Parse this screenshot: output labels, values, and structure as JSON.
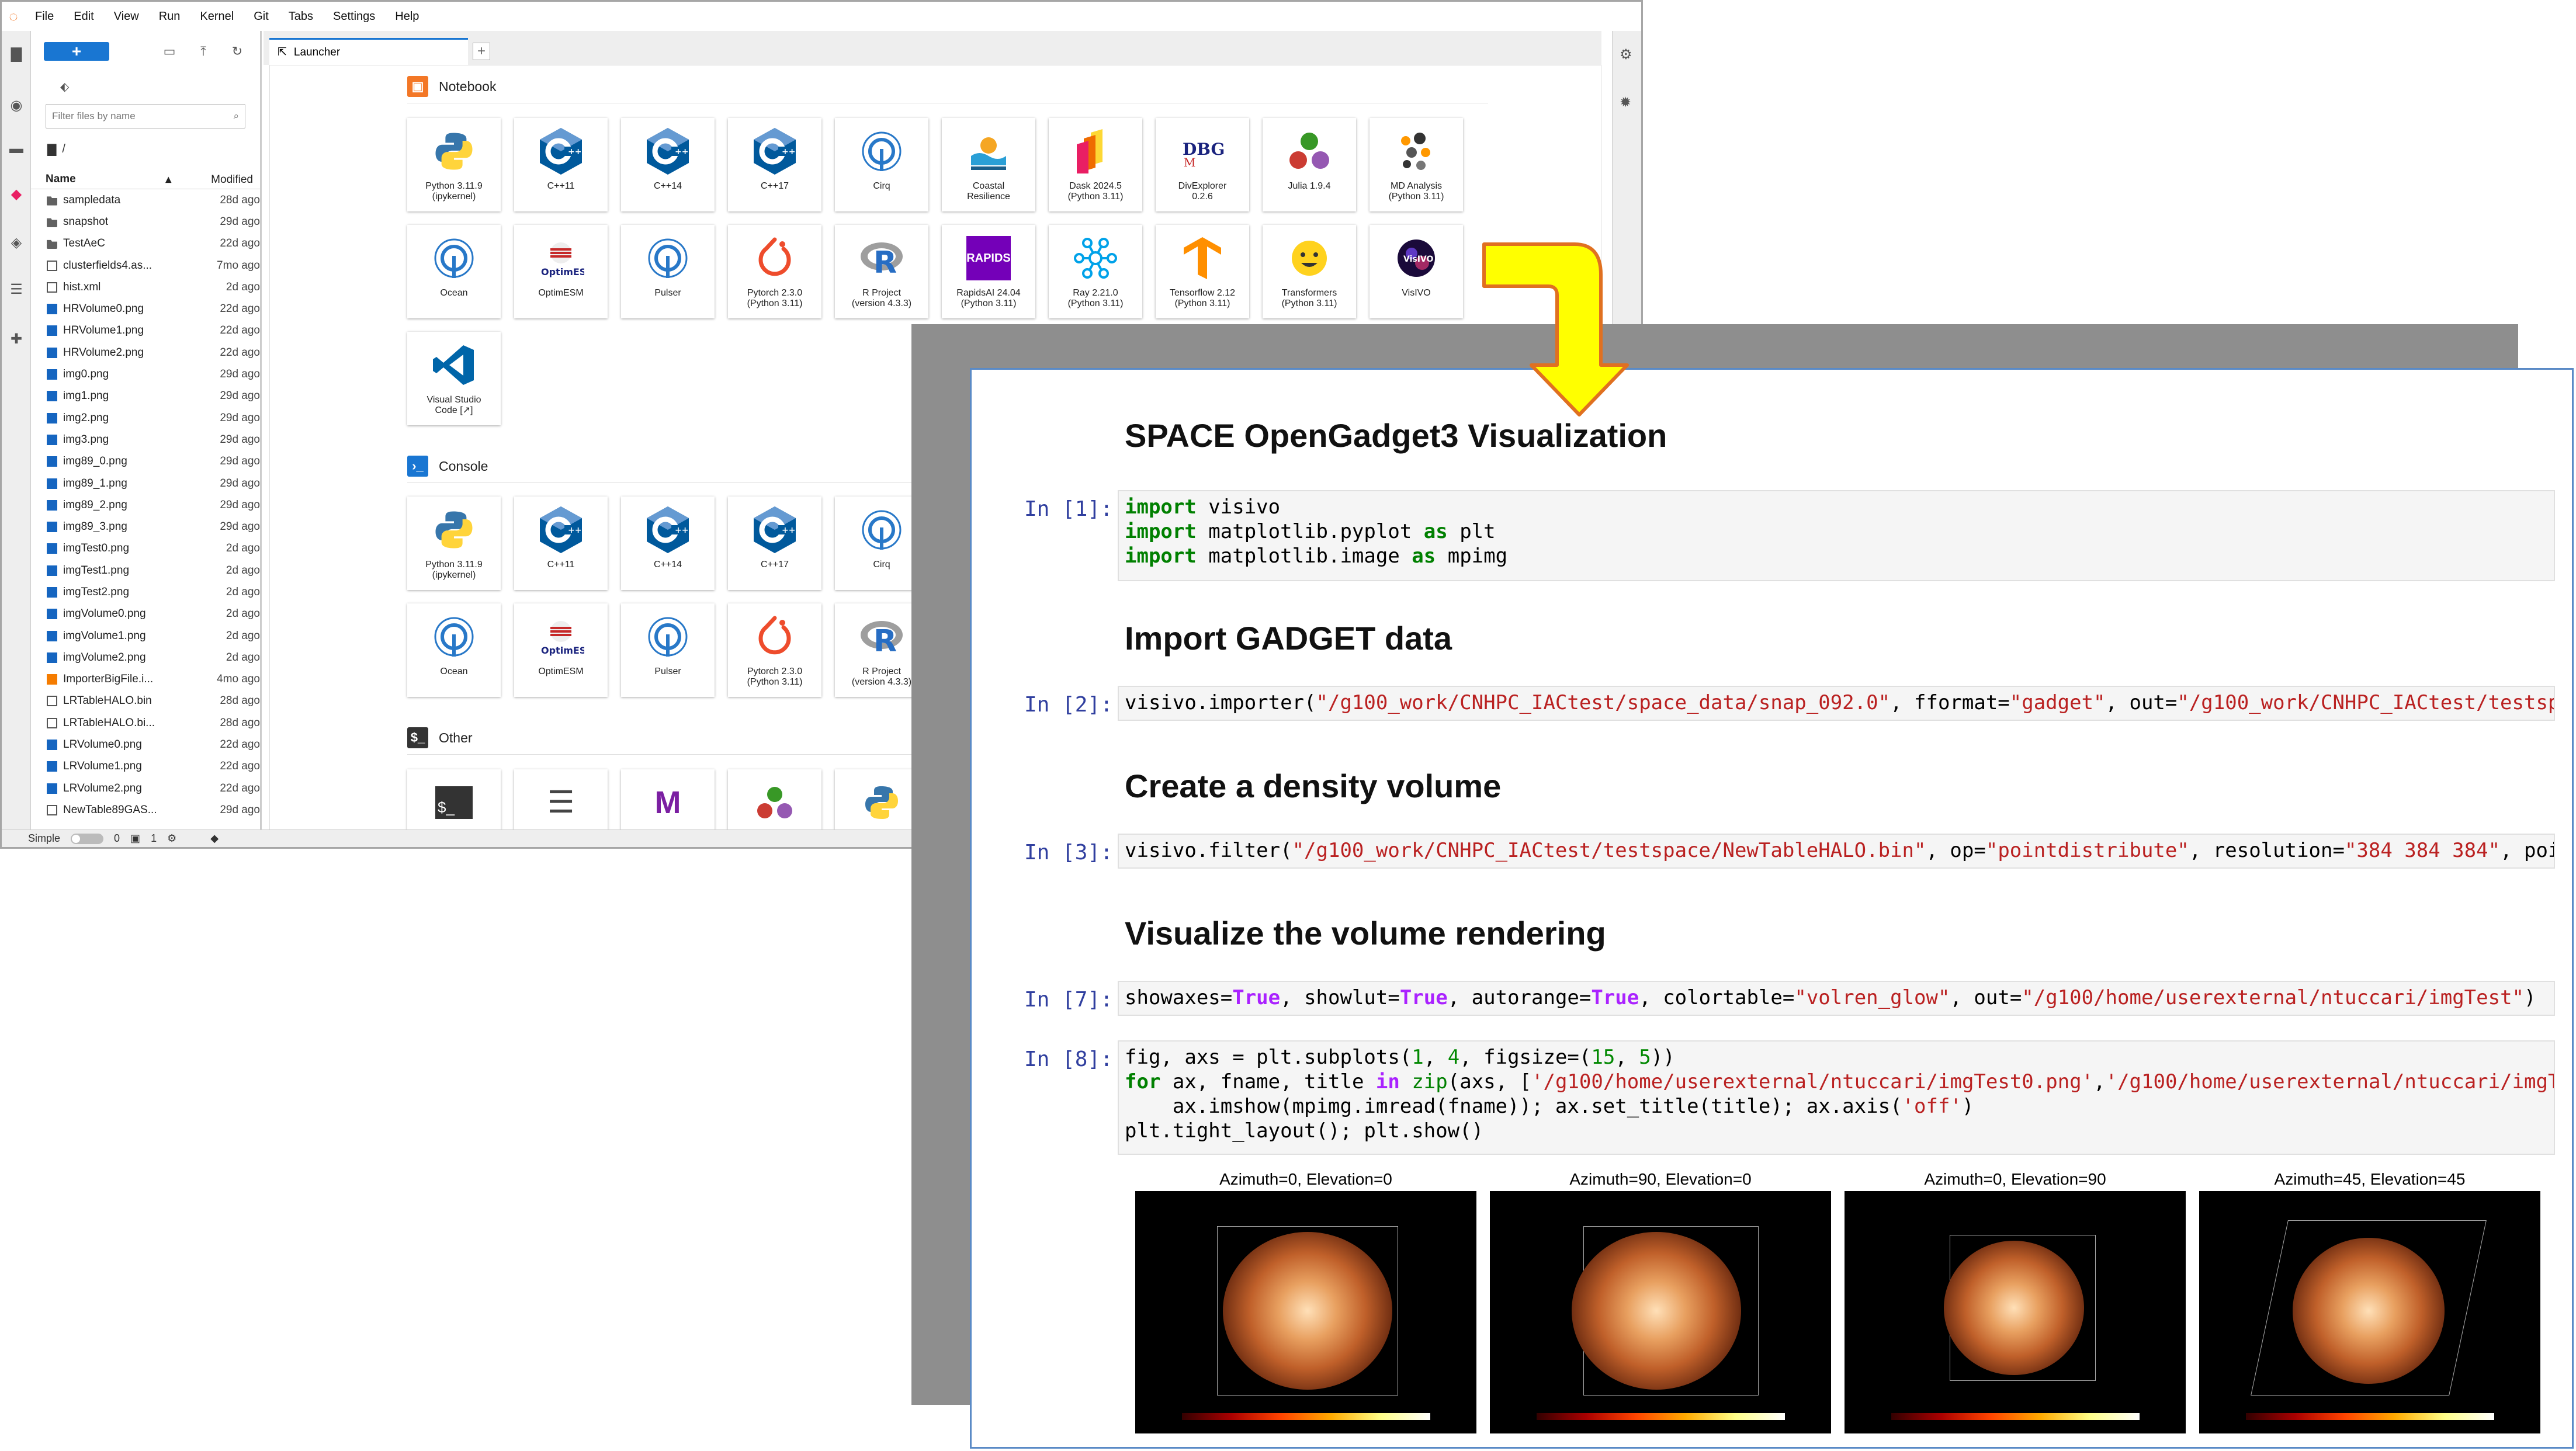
{
  "menu": {
    "items": [
      "File",
      "Edit",
      "View",
      "Run",
      "Kernel",
      "Git",
      "Tabs",
      "Settings",
      "Help"
    ]
  },
  "filebrowser": {
    "new_label": "+",
    "filter_placeholder": "Filter files by name",
    "path": "/",
    "col_name": "Name",
    "col_modified": "Modified",
    "files": [
      {
        "name": "sampledata",
        "date": "28d ago",
        "type": "folder"
      },
      {
        "name": "snapshot",
        "date": "29d ago",
        "type": "folder"
      },
      {
        "name": "TestAeC",
        "date": "22d ago",
        "type": "folder"
      },
      {
        "name": "clusterfields4.as...",
        "date": "7mo ago",
        "type": "file"
      },
      {
        "name": "hist.xml",
        "date": "2d ago",
        "type": "file"
      },
      {
        "name": "HRVolume0.png",
        "date": "22d ago",
        "type": "img"
      },
      {
        "name": "HRVolume1.png",
        "date": "22d ago",
        "type": "img"
      },
      {
        "name": "HRVolume2.png",
        "date": "22d ago",
        "type": "img"
      },
      {
        "name": "img0.png",
        "date": "29d ago",
        "type": "img"
      },
      {
        "name": "img1.png",
        "date": "29d ago",
        "type": "img"
      },
      {
        "name": "img2.png",
        "date": "29d ago",
        "type": "img"
      },
      {
        "name": "img3.png",
        "date": "29d ago",
        "type": "img"
      },
      {
        "name": "img89_0.png",
        "date": "29d ago",
        "type": "img"
      },
      {
        "name": "img89_1.png",
        "date": "29d ago",
        "type": "img"
      },
      {
        "name": "img89_2.png",
        "date": "29d ago",
        "type": "img"
      },
      {
        "name": "img89_3.png",
        "date": "29d ago",
        "type": "img"
      },
      {
        "name": "imgTest0.png",
        "date": "2d ago",
        "type": "img"
      },
      {
        "name": "imgTest1.png",
        "date": "2d ago",
        "type": "img"
      },
      {
        "name": "imgTest2.png",
        "date": "2d ago",
        "type": "img"
      },
      {
        "name": "imgVolume0.png",
        "date": "2d ago",
        "type": "img"
      },
      {
        "name": "imgVolume1.png",
        "date": "2d ago",
        "type": "img"
      },
      {
        "name": "imgVolume2.png",
        "date": "2d ago",
        "type": "img"
      },
      {
        "name": "ImporterBigFile.i...",
        "date": "4mo ago",
        "type": "json"
      },
      {
        "name": "LRTableHALO.bin",
        "date": "28d ago",
        "type": "file"
      },
      {
        "name": "LRTableHALO.bi...",
        "date": "28d ago",
        "type": "file"
      },
      {
        "name": "LRVolume0.png",
        "date": "22d ago",
        "type": "img"
      },
      {
        "name": "LRVolume1.png",
        "date": "22d ago",
        "type": "img"
      },
      {
        "name": "LRVolume2.png",
        "date": "22d ago",
        "type": "img"
      },
      {
        "name": "NewTable89GAS...",
        "date": "29d ago",
        "type": "file"
      }
    ]
  },
  "tab": {
    "label": "Launcher"
  },
  "launcher": {
    "notebook_label": "Notebook",
    "console_label": "Console",
    "other_label": "Other",
    "notebook": [
      {
        "label": "Python 3.11.9\n(ipykernel)",
        "icon": "python-icon"
      },
      {
        "label": "C++11",
        "icon": "cpp-icon"
      },
      {
        "label": "C++14",
        "icon": "cpp-icon"
      },
      {
        "label": "C++17",
        "icon": "cpp-icon"
      },
      {
        "label": "Cirq",
        "icon": "cirq-icon"
      },
      {
        "label": "Coastal\nResilience",
        "icon": "coastal-icon"
      },
      {
        "label": "Dask 2024.5\n(Python 3.11)",
        "icon": "dask-icon"
      },
      {
        "label": "DivExplorer\n0.2.6",
        "icon": "divexplorer-icon"
      },
      {
        "label": "Julia 1.9.4",
        "icon": "julia-icon"
      },
      {
        "label": "MD Analysis\n(Python 3.11)",
        "icon": "mdanalysis-icon"
      },
      {
        "label": "Ocean",
        "icon": "ocean-icon"
      },
      {
        "label": "OptimESM",
        "icon": "optimesm-icon"
      },
      {
        "label": "Pulser",
        "icon": "pulser-icon"
      },
      {
        "label": "Pytorch 2.3.0\n(Python 3.11)",
        "icon": "pytorch-icon"
      },
      {
        "label": "R Project\n(version 4.3.3)",
        "icon": "r-icon"
      },
      {
        "label": "RapidsAI 24.04\n(Python 3.11)",
        "icon": "rapids-icon"
      },
      {
        "label": "Ray 2.21.0\n(Python 3.11)",
        "icon": "ray-icon"
      },
      {
        "label": "Tensorflow 2.12\n(Python 3.11)",
        "icon": "tensorflow-icon"
      },
      {
        "label": "Transformers\n(Python 3.11)",
        "icon": "transformers-icon"
      },
      {
        "label": "VisIVO",
        "icon": "visivo-icon"
      },
      {
        "label": "Visual Studio\nCode [↗]",
        "icon": "vscode-icon"
      }
    ],
    "console": [
      {
        "label": "Python 3.11.9\n(ipykernel)",
        "icon": "python-icon"
      },
      {
        "label": "C++11",
        "icon": "cpp-icon"
      },
      {
        "label": "C++14",
        "icon": "cpp-icon"
      },
      {
        "label": "C++17",
        "icon": "cpp-icon"
      },
      {
        "label": "Cirq",
        "icon": "cirq-icon"
      },
      {
        "label": "Ocean",
        "icon": "ocean-icon"
      },
      {
        "label": "OptimESM",
        "icon": "optimesm-icon"
      },
      {
        "label": "Pulser",
        "icon": "pulser-icon"
      },
      {
        "label": "Pytorch 2.3.0\n(Python 3.11)",
        "icon": "pytorch-icon"
      },
      {
        "label": "R Project\n(version 4.3.3)",
        "icon": "r-icon"
      }
    ]
  },
  "status": {
    "mode": "Simple",
    "kernels": "0",
    "terminals": "1"
  },
  "notebook": {
    "h1": "SPACE OpenGadget3 Visualization",
    "h2a": "Import GADGET data",
    "h2b": "Create a density volume",
    "h2c": "Visualize the volume rendering",
    "prompts": [
      "In [1]:",
      "In [2]:",
      "In [3]:",
      "In [7]:",
      "In [8]:"
    ],
    "plot_titles": [
      "Azimuth=0, Elevation=0",
      "Azimuth=90, Elevation=0",
      "Azimuth=0, Elevation=90",
      "Azimuth=45, Elevation=45"
    ]
  },
  "colors": {
    "accent": "#1976d2",
    "arrow": "#ffff00",
    "arrow_border": "#e07020"
  }
}
